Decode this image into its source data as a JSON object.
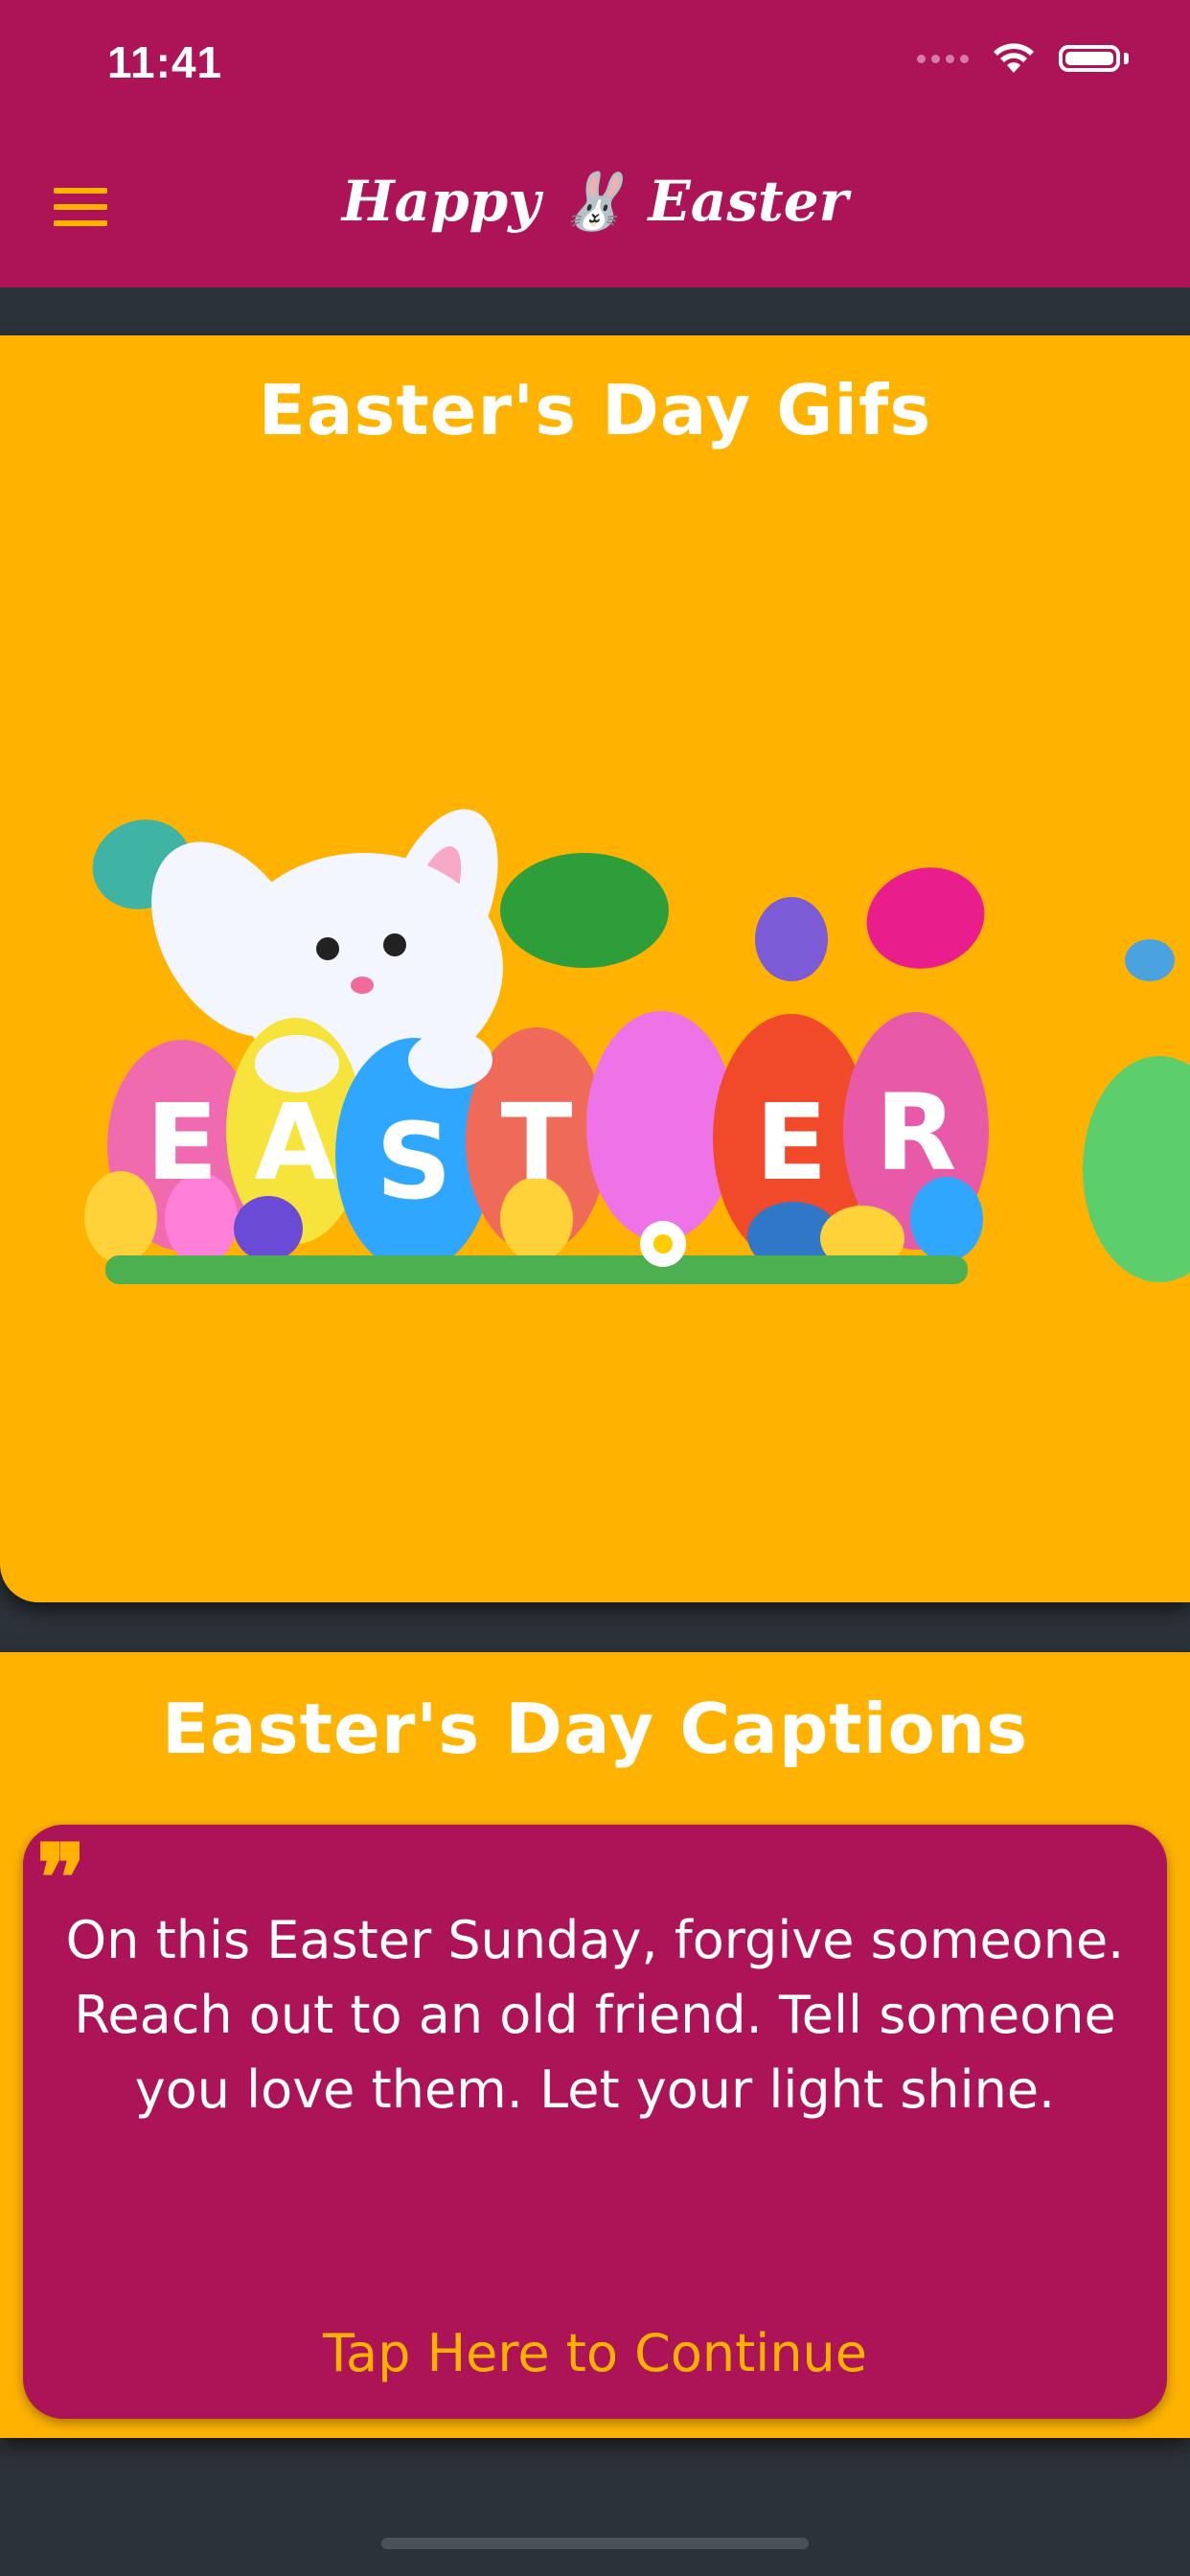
{
  "status_bar": {
    "time": "11:41"
  },
  "nav": {
    "title": "Happy 🐰 Easter",
    "menu_icon": "hamburger-menu-icon"
  },
  "gifs_card": {
    "title": "Easter's Day Gifs",
    "letters": [
      "E",
      "A",
      "S",
      "T",
      "E",
      "R"
    ]
  },
  "captions_card": {
    "title": "Easter's Day Captions",
    "quote_mark": "❞",
    "quote": "On this Easter Sunday, forgive someone. Reach out to an old friend. Tell someone you love them. Let your light shine.",
    "continue_label": "Tap Here to Continue"
  },
  "colors": {
    "primary": "#ad1457",
    "accent": "#ffb300",
    "background": "#2b3238"
  }
}
